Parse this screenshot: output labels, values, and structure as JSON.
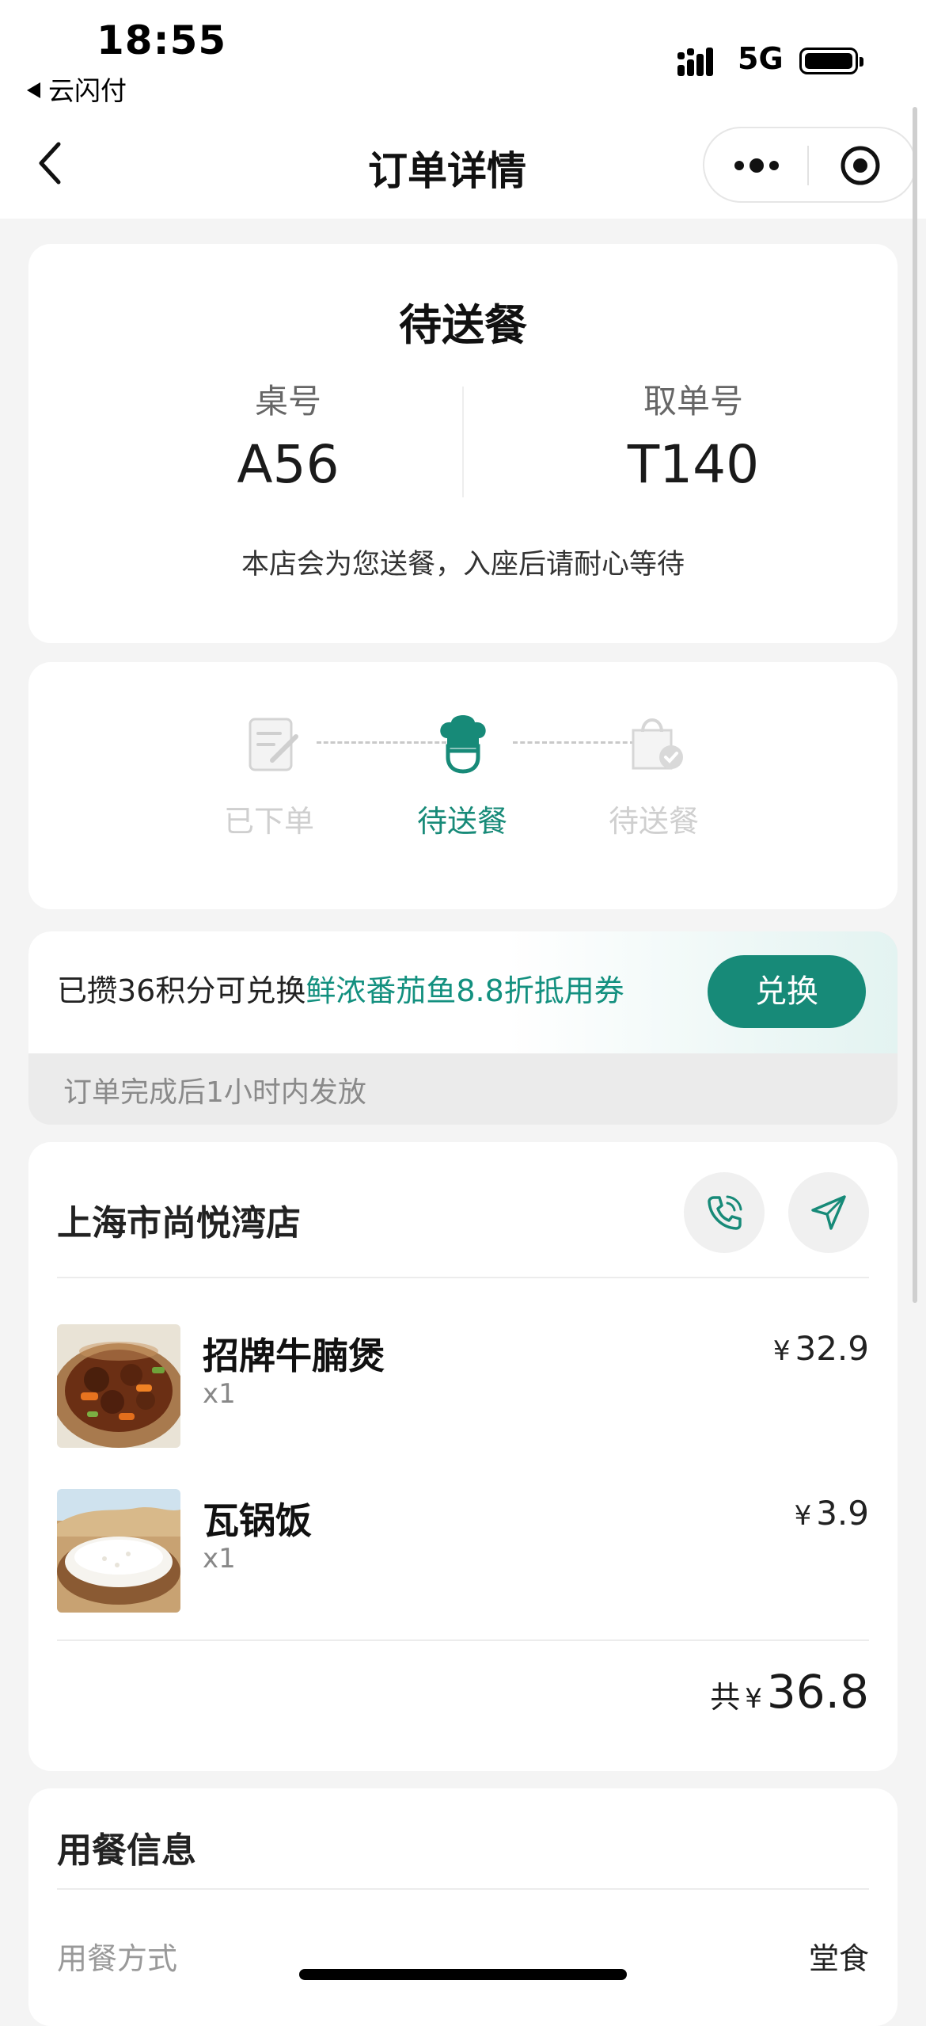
{
  "status_bar": {
    "time": "18:55",
    "back_app": "云闪付",
    "network": "5G"
  },
  "nav": {
    "title": "订单详情"
  },
  "order_status": {
    "title": "待送餐",
    "table_label": "桌号",
    "table_value": "A56",
    "pickup_label": "取单号",
    "pickup_value": "T140",
    "hint": "本店会为您送餐，入座后请耐心等待"
  },
  "progress": {
    "steps": [
      {
        "label": "已下单",
        "active": false
      },
      {
        "label": "待送餐",
        "active": true
      },
      {
        "label": "待送餐",
        "active": false
      }
    ],
    "active_color": "#178a78",
    "inactive_color": "#cfcfcf"
  },
  "promo": {
    "text_prefix": "已攒36积分可兑换",
    "text_highlight": "鲜浓番茄鱼8.8折抵用券",
    "button_label": "兑换",
    "note": "订单完成后1小时内发放"
  },
  "store": {
    "name": "上海市尚悦湾店",
    "items": [
      {
        "name": "招牌牛腩煲",
        "qty": "x1",
        "price": "32.9"
      },
      {
        "name": "瓦锅饭",
        "qty": "x1",
        "price": "3.9"
      }
    ],
    "currency_symbol": "¥",
    "total_label": "共",
    "total_value": "36.8"
  },
  "dining_info": {
    "title": "用餐信息",
    "method_label": "用餐方式",
    "method_value": "堂食"
  }
}
